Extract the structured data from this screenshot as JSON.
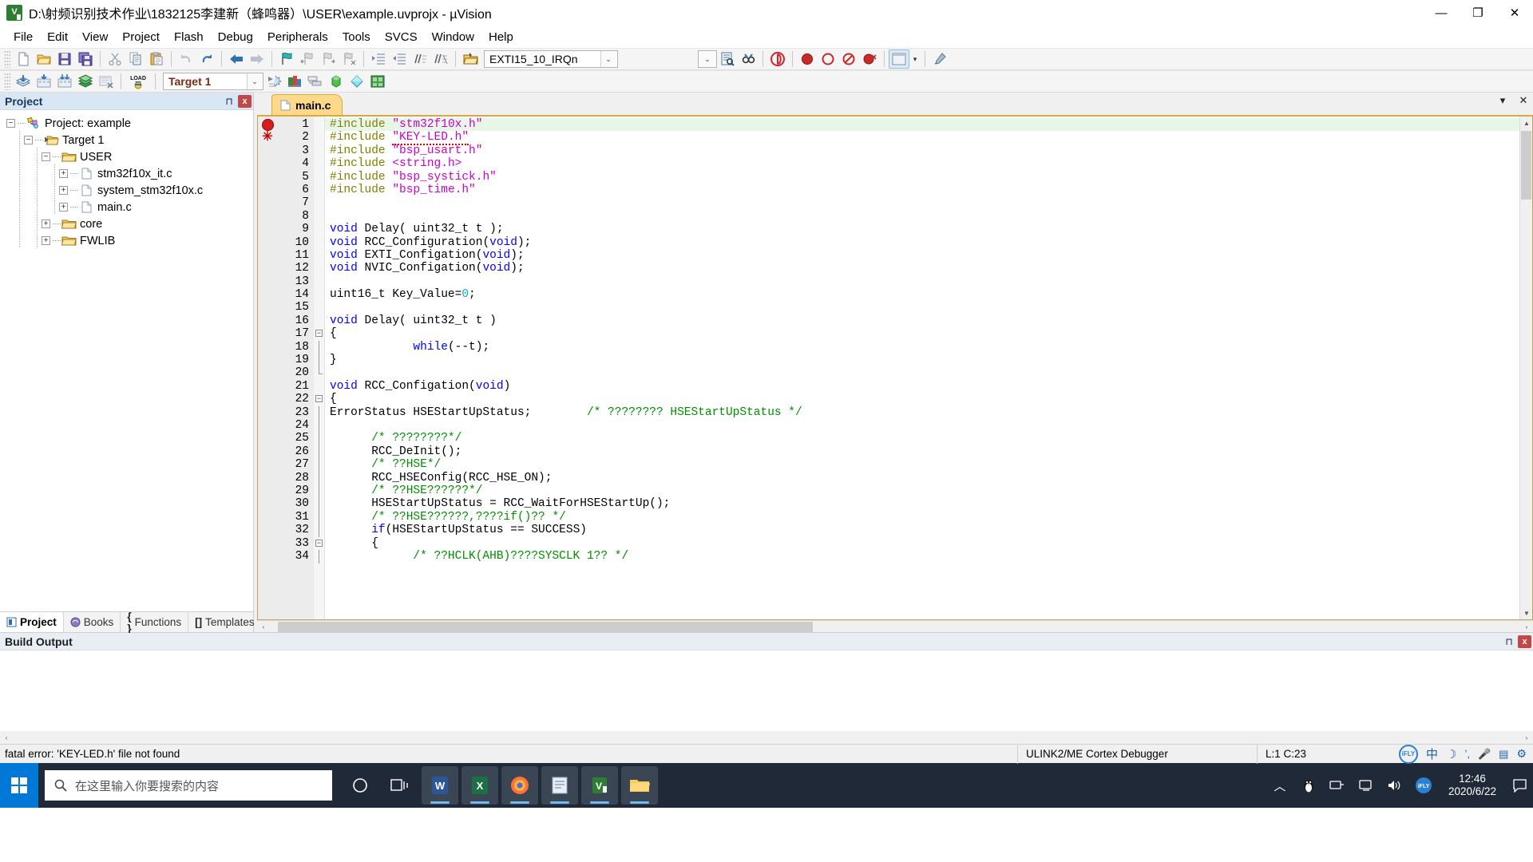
{
  "window": {
    "title": "D:\\射频识别技术作业\\1832125李建新（蜂鸣器）\\USER\\example.uvprojx - µVision",
    "app_icon": "uvision-icon",
    "minimize": "—",
    "maximize": "❐",
    "close": "✕"
  },
  "menubar": {
    "items": [
      {
        "label": "File"
      },
      {
        "label": "Edit"
      },
      {
        "label": "View"
      },
      {
        "label": "Project"
      },
      {
        "label": "Flash"
      },
      {
        "label": "Debug"
      },
      {
        "label": "Peripherals"
      },
      {
        "label": "Tools"
      },
      {
        "label": "SVCS"
      },
      {
        "label": "Window"
      },
      {
        "label": "Help"
      }
    ]
  },
  "toolbar_main": {
    "buttons": [
      {
        "name": "new-file-icon",
        "title": "New"
      },
      {
        "name": "open-folder-icon",
        "title": "Open"
      },
      {
        "name": "save-icon",
        "title": "Save"
      },
      {
        "name": "save-all-icon",
        "title": "Save All"
      },
      {
        "name": "cut-icon",
        "title": "Cut"
      },
      {
        "name": "copy-icon",
        "title": "Copy"
      },
      {
        "name": "paste-icon",
        "title": "Paste"
      },
      {
        "name": "undo-icon",
        "title": "Undo"
      },
      {
        "name": "redo-icon",
        "title": "Redo"
      },
      {
        "name": "navigate-back-icon",
        "title": "Back"
      },
      {
        "name": "navigate-forward-icon",
        "title": "Forward"
      },
      {
        "name": "bookmark-toggle-icon",
        "title": "Insert/Remove Bookmark"
      },
      {
        "name": "bookmark-prev-icon",
        "title": "Previous Bookmark"
      },
      {
        "name": "bookmark-next-icon",
        "title": "Next Bookmark"
      },
      {
        "name": "bookmark-clear-icon",
        "title": "Clear All Bookmarks"
      },
      {
        "name": "indent-icon",
        "title": "Indent"
      },
      {
        "name": "outdent-icon",
        "title": "Outdent"
      },
      {
        "name": "comment-icon",
        "title": "Comment"
      },
      {
        "name": "uncomment-icon",
        "title": "Uncomment"
      },
      {
        "name": "open-document-icon",
        "title": "Open Document"
      }
    ],
    "irq_combo": {
      "value": "EXTI15_10_IRQn",
      "arrow": "⌄"
    },
    "right_buttons": [
      {
        "name": "find-in-files-icon",
        "title": "Find in Files"
      },
      {
        "name": "binoculars-icon",
        "title": "Find"
      },
      {
        "name": "debug-start-icon",
        "title": "Start/Stop Debug Session"
      },
      {
        "name": "breakpoint-insert-icon",
        "title": "Insert/Remove Breakpoint"
      },
      {
        "name": "breakpoint-disable-icon",
        "title": "Enable/Disable Breakpoint"
      },
      {
        "name": "breakpoint-disable-all-icon",
        "title": "Disable All Breakpoints"
      },
      {
        "name": "breakpoint-kill-all-icon",
        "title": "Kill All Breakpoints"
      },
      {
        "name": "window-layout-icon",
        "title": "Manage Window Layout"
      },
      {
        "name": "configuration-wizard-icon",
        "title": "Configuration Wizard"
      }
    ]
  },
  "toolbar_build": {
    "buttons": [
      {
        "name": "translate-icon",
        "title": "Translate"
      },
      {
        "name": "build-icon",
        "title": "Build"
      },
      {
        "name": "rebuild-icon",
        "title": "Rebuild"
      },
      {
        "name": "batch-build-icon",
        "title": "Batch Build"
      },
      {
        "name": "stop-build-icon",
        "title": "Stop Build"
      },
      {
        "name": "load-icon",
        "title": "Download"
      }
    ],
    "target_combo": {
      "value": "Target 1",
      "arrow": "⌄"
    },
    "right_buttons": [
      {
        "name": "target-options-icon",
        "title": "Options for Target"
      },
      {
        "name": "manage-run-time-env-icon",
        "title": "Manage Run-Time Environment"
      },
      {
        "name": "multi-project-icon",
        "title": "Manage Multi-Project"
      },
      {
        "name": "pack-installer-icon",
        "title": "Pack Installer"
      },
      {
        "name": "svcs-icon",
        "title": "SVCS"
      },
      {
        "name": "utilities-icon",
        "title": "Utilities"
      }
    ]
  },
  "project_panel": {
    "caption": "Project",
    "pin": "⊓",
    "close": "x",
    "tree": [
      {
        "label": "Project: example",
        "icon": "project-icon",
        "depth": 0,
        "expander": "−"
      },
      {
        "label": "Target 1",
        "icon": "target-icon",
        "depth": 1,
        "expander": "−"
      },
      {
        "label": "USER",
        "icon": "folder-icon",
        "depth": 2,
        "expander": "−"
      },
      {
        "label": "stm32f10x_it.c",
        "icon": "c-file-icon",
        "depth": 3,
        "expander": "+"
      },
      {
        "label": "system_stm32f10x.c",
        "icon": "c-file-icon",
        "depth": 3,
        "expander": "+"
      },
      {
        "label": "main.c",
        "icon": "c-file-icon",
        "depth": 3,
        "expander": "+"
      },
      {
        "label": "core",
        "icon": "folder-icon",
        "depth": 2,
        "expander": "+"
      },
      {
        "label": "FWLIB",
        "icon": "folder-icon",
        "depth": 2,
        "expander": "+"
      }
    ],
    "tabs": [
      {
        "label": "Project",
        "icon": "project-tab-icon",
        "active": true
      },
      {
        "label": "Books",
        "icon": "books-tab-icon",
        "active": false
      },
      {
        "label": "Functions",
        "icon": "functions-tab-icon",
        "active": false
      },
      {
        "label": "Templates",
        "icon": "templates-tab-icon",
        "active": false
      }
    ]
  },
  "editor": {
    "tab": {
      "label": "main.c",
      "icon": "c-file-icon"
    },
    "tabstrip_buttons": [
      {
        "name": "tab-list-icon",
        "label": "▾"
      },
      {
        "name": "tab-close-icon",
        "label": "✕"
      }
    ],
    "markers": [
      {
        "line": 1,
        "type": "breakpoint"
      },
      {
        "line": 2,
        "type": "error"
      }
    ],
    "lines": [
      {
        "n": 1,
        "fold": "",
        "current": true,
        "tokens": [
          {
            "t": "#include ",
            "c": "pp"
          },
          {
            "t": "\"stm32f10x.h\"",
            "c": "str"
          }
        ]
      },
      {
        "n": 2,
        "fold": "",
        "current": false,
        "tokens": [
          {
            "t": "#include ",
            "c": "pp"
          },
          {
            "t": "\"KEY-LED.h\"",
            "c": "str"
          }
        ]
      },
      {
        "n": 3,
        "fold": "",
        "current": false,
        "tokens": [
          {
            "t": "#include ",
            "c": "pp"
          },
          {
            "t": "\"bsp_usart.h\"",
            "c": "str"
          }
        ]
      },
      {
        "n": 4,
        "fold": "",
        "current": false,
        "tokens": [
          {
            "t": "#include ",
            "c": "pp"
          },
          {
            "t": "<string.h>",
            "c": "str"
          }
        ]
      },
      {
        "n": 5,
        "fold": "",
        "current": false,
        "tokens": [
          {
            "t": "#include ",
            "c": "pp"
          },
          {
            "t": "\"bsp_systick.h\"",
            "c": "str"
          }
        ]
      },
      {
        "n": 6,
        "fold": "",
        "current": false,
        "tokens": [
          {
            "t": "#include ",
            "c": "pp"
          },
          {
            "t": "\"bsp_time.h\"",
            "c": "str"
          }
        ]
      },
      {
        "n": 7,
        "fold": "",
        "current": false,
        "tokens": []
      },
      {
        "n": 8,
        "fold": "",
        "current": false,
        "tokens": []
      },
      {
        "n": 9,
        "fold": "",
        "current": false,
        "tokens": [
          {
            "t": "void",
            "c": "k"
          },
          {
            "t": " Delay( uint32_t t );",
            "c": "pln"
          }
        ]
      },
      {
        "n": 10,
        "fold": "",
        "current": false,
        "tokens": [
          {
            "t": "void",
            "c": "k"
          },
          {
            "t": " RCC_Configuration(",
            "c": "pln"
          },
          {
            "t": "void",
            "c": "k"
          },
          {
            "t": ");",
            "c": "pln"
          }
        ]
      },
      {
        "n": 11,
        "fold": "",
        "current": false,
        "tokens": [
          {
            "t": "void",
            "c": "k"
          },
          {
            "t": " EXTI_Configation(",
            "c": "pln"
          },
          {
            "t": "void",
            "c": "k"
          },
          {
            "t": ");",
            "c": "pln"
          }
        ]
      },
      {
        "n": 12,
        "fold": "",
        "current": false,
        "tokens": [
          {
            "t": "void",
            "c": "k"
          },
          {
            "t": " NVIC_Configation(",
            "c": "pln"
          },
          {
            "t": "void",
            "c": "k"
          },
          {
            "t": ");",
            "c": "pln"
          }
        ]
      },
      {
        "n": 13,
        "fold": "",
        "current": false,
        "tokens": []
      },
      {
        "n": 14,
        "fold": "",
        "current": false,
        "tokens": [
          {
            "t": "uint16_t Key_Value=",
            "c": "pln"
          },
          {
            "t": "0",
            "c": "num"
          },
          {
            "t": ";",
            "c": "pln"
          }
        ]
      },
      {
        "n": 15,
        "fold": "",
        "current": false,
        "tokens": []
      },
      {
        "n": 16,
        "fold": "",
        "current": false,
        "tokens": [
          {
            "t": "void",
            "c": "k"
          },
          {
            "t": " Delay( uint32_t t )",
            "c": "pln"
          }
        ]
      },
      {
        "n": 17,
        "fold": "open",
        "current": false,
        "tokens": [
          {
            "t": "{",
            "c": "pln"
          }
        ]
      },
      {
        "n": 18,
        "fold": "bar",
        "current": false,
        "tokens": [
          {
            "t": "            ",
            "c": "pln"
          },
          {
            "t": "while",
            "c": "k"
          },
          {
            "t": "(--t);",
            "c": "pln"
          }
        ]
      },
      {
        "n": 19,
        "fold": "bar",
        "current": false,
        "tokens": [
          {
            "t": "}",
            "c": "pln"
          }
        ]
      },
      {
        "n": 20,
        "fold": "end",
        "current": false,
        "tokens": []
      },
      {
        "n": 21,
        "fold": "",
        "current": false,
        "tokens": [
          {
            "t": "void",
            "c": "k"
          },
          {
            "t": " RCC_Configation(",
            "c": "pln"
          },
          {
            "t": "void",
            "c": "k"
          },
          {
            "t": ")",
            "c": "pln"
          }
        ]
      },
      {
        "n": 22,
        "fold": "open",
        "current": false,
        "tokens": [
          {
            "t": "{",
            "c": "pln"
          }
        ]
      },
      {
        "n": 23,
        "fold": "bar",
        "current": false,
        "tokens": [
          {
            "t": "ErrorStatus HSEStartUpStatus;        ",
            "c": "pln"
          },
          {
            "t": "/* ???????? HSEStartUpStatus */",
            "c": "cmt"
          }
        ]
      },
      {
        "n": 24,
        "fold": "bar",
        "current": false,
        "tokens": []
      },
      {
        "n": 25,
        "fold": "bar",
        "current": false,
        "tokens": [
          {
            "t": "      ",
            "c": "pln"
          },
          {
            "t": "/* ????????*/",
            "c": "cmt"
          }
        ]
      },
      {
        "n": 26,
        "fold": "bar",
        "current": false,
        "tokens": [
          {
            "t": "      RCC_DeInit();",
            "c": "pln"
          }
        ]
      },
      {
        "n": 27,
        "fold": "bar",
        "current": false,
        "tokens": [
          {
            "t": "      ",
            "c": "pln"
          },
          {
            "t": "/* ??HSE*/",
            "c": "cmt"
          }
        ]
      },
      {
        "n": 28,
        "fold": "bar",
        "current": false,
        "tokens": [
          {
            "t": "      RCC_HSEConfig(RCC_HSE_ON);",
            "c": "pln"
          }
        ]
      },
      {
        "n": 29,
        "fold": "bar",
        "current": false,
        "tokens": [
          {
            "t": "      ",
            "c": "pln"
          },
          {
            "t": "/* ??HSE??????*/",
            "c": "cmt"
          }
        ]
      },
      {
        "n": 30,
        "fold": "bar",
        "current": false,
        "tokens": [
          {
            "t": "      HSEStartUpStatus = RCC_WaitForHSEStartUp();",
            "c": "pln"
          }
        ]
      },
      {
        "n": 31,
        "fold": "bar",
        "current": false,
        "tokens": [
          {
            "t": "      ",
            "c": "pln"
          },
          {
            "t": "/* ??HSE??????,????if()?? */",
            "c": "cmt"
          }
        ]
      },
      {
        "n": 32,
        "fold": "bar",
        "current": false,
        "tokens": [
          {
            "t": "      ",
            "c": "pln"
          },
          {
            "t": "if",
            "c": "k"
          },
          {
            "t": "(HSEStartUpStatus == SUCCESS)",
            "c": "pln"
          }
        ]
      },
      {
        "n": 33,
        "fold": "open",
        "current": false,
        "tokens": [
          {
            "t": "      {",
            "c": "pln"
          }
        ]
      },
      {
        "n": 34,
        "fold": "bar",
        "current": false,
        "tokens": [
          {
            "t": "            ",
            "c": "pln"
          },
          {
            "t": "/* ??HCLK(AHB)????SYSCLK 1?? */",
            "c": "cmt"
          }
        ]
      }
    ],
    "scroll": {
      "up": "▲",
      "down": "▼",
      "left": "‹",
      "right": "›"
    }
  },
  "build_output": {
    "caption": "Build Output",
    "pin": "⊓",
    "close": "x",
    "text": ""
  },
  "statusbar": {
    "message": "fatal error: 'KEY-LED.h' file not found",
    "debugger": "ULINK2/ME Cortex Debugger",
    "cursor": "L:1 C:23",
    "ime": [
      {
        "name": "ifly-icon",
        "label": "iFLY"
      },
      {
        "name": "chinese-mode-icon",
        "label": "中"
      },
      {
        "name": "moon-icon",
        "label": "☽"
      },
      {
        "name": "punctuation-icon",
        "label": "ʼ,"
      },
      {
        "name": "microphone-icon",
        "label": "🎤"
      },
      {
        "name": "handwriting-icon",
        "label": "▤"
      },
      {
        "name": "settings-gear-icon",
        "label": "⚙"
      }
    ]
  },
  "taskbar": {
    "start": "windows-logo-icon",
    "search": {
      "placeholder": "在这里输入你要搜索的内容",
      "icon": "search-icon"
    },
    "apps": [
      {
        "name": "cortana-icon",
        "label": "○",
        "active": false
      },
      {
        "name": "task-view-icon",
        "label": "⊟",
        "active": false
      },
      {
        "name": "word-icon",
        "label": "W",
        "active": true
      },
      {
        "name": "excel-icon",
        "label": "X",
        "active": true
      },
      {
        "name": "firefox-icon",
        "label": "🦊",
        "active": true
      },
      {
        "name": "notepad-icon",
        "label": "▤",
        "active": true
      },
      {
        "name": "uvision-icon",
        "label": "V",
        "active": true
      },
      {
        "name": "file-explorer-icon",
        "label": "🗀",
        "active": true
      }
    ],
    "tray": [
      {
        "name": "show-hidden-icons-chevron",
        "label": "︿"
      },
      {
        "name": "qq-penguin-icon",
        "label": "🐧"
      },
      {
        "name": "network-tray-icon",
        "label": "▭"
      },
      {
        "name": "display-tray-icon",
        "label": "🖵"
      },
      {
        "name": "volume-tray-icon",
        "label": "🔊"
      },
      {
        "name": "ifly-tray-icon",
        "label": "iFLY"
      }
    ],
    "clock": {
      "time": "12:46",
      "date": "2020/6/22"
    },
    "action_center": "notification-icon"
  }
}
